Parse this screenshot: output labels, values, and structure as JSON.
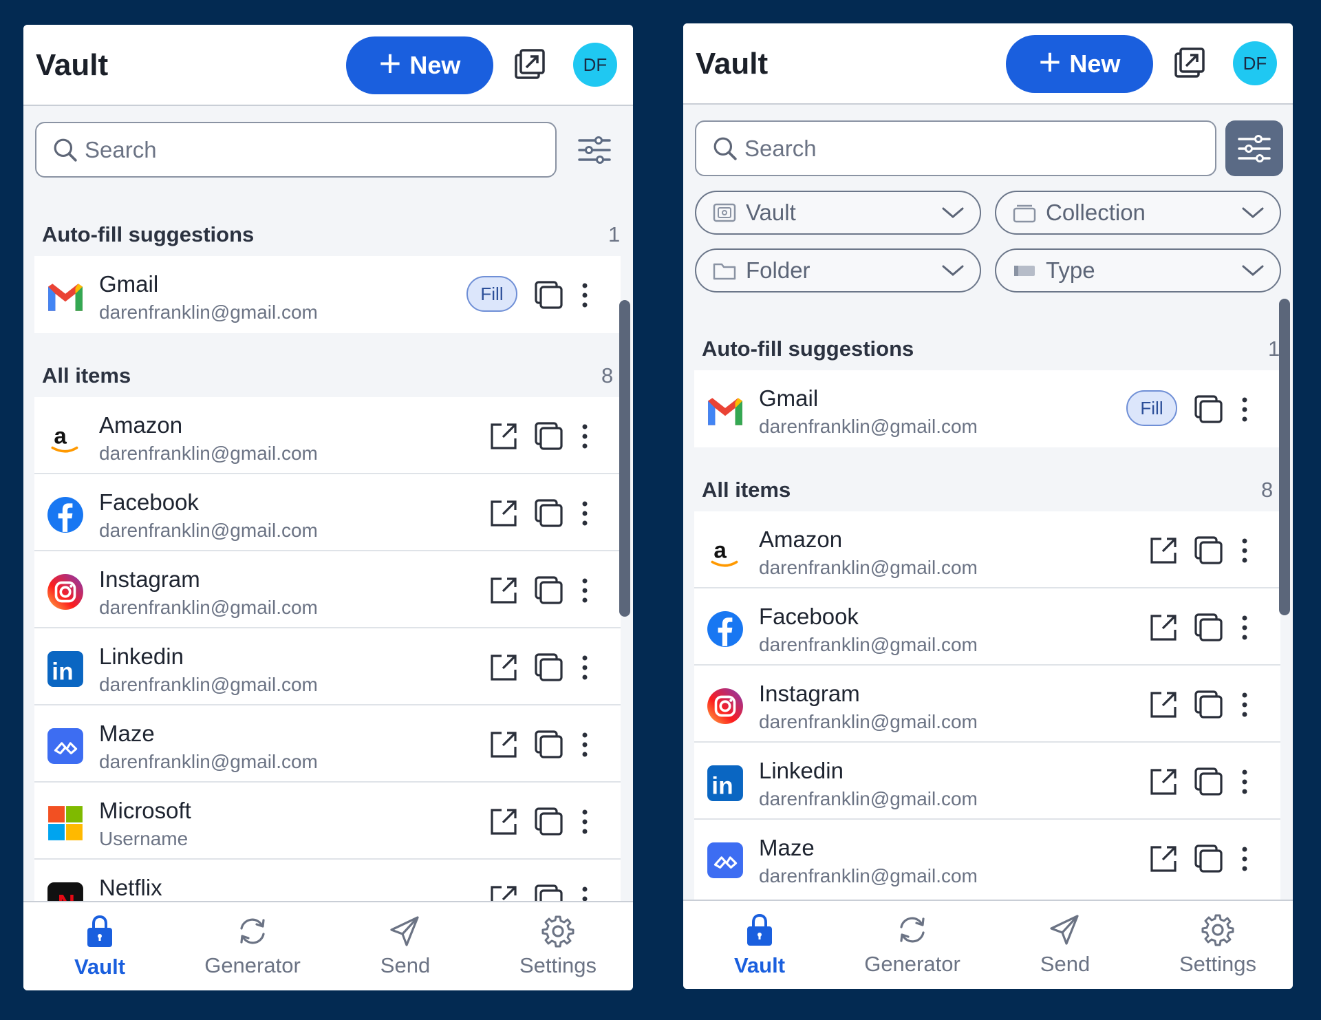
{
  "colors": {
    "background": "#032a52",
    "accent": "#1a5fde",
    "avatar": "#1fc8f2"
  },
  "vault_title": "Vault",
  "new_button_label": "New",
  "avatar_initials": "DF",
  "search_placeholder": "Search",
  "filters": {
    "vault": "Vault",
    "collection": "Collection",
    "folder": "Folder",
    "type": "Type"
  },
  "autofill": {
    "title": "Auto-fill suggestions",
    "count": "1",
    "fill_label": "Fill",
    "items": [
      {
        "name": "Gmail",
        "sub": "darenfranklin@gmail.com",
        "icon": "gmail-logo"
      }
    ]
  },
  "all_items": {
    "title": "All items",
    "count": "8",
    "items": [
      {
        "name": "Amazon",
        "sub": "darenfranklin@gmail.com",
        "icon": "amazon-logo"
      },
      {
        "name": "Facebook",
        "sub": "darenfranklin@gmail.com",
        "icon": "facebook-logo"
      },
      {
        "name": "Instagram",
        "sub": "darenfranklin@gmail.com",
        "icon": "instagram-logo"
      },
      {
        "name": "Linkedin",
        "sub": "darenfranklin@gmail.com",
        "icon": "linkedin-logo"
      },
      {
        "name": "Maze",
        "sub": "darenfranklin@gmail.com",
        "icon": "maze-logo"
      },
      {
        "name": "Microsoft",
        "sub": "Username",
        "icon": "microsoft-logo"
      },
      {
        "name": "Netflix",
        "sub": "",
        "icon": "netflix-logo"
      }
    ]
  },
  "tabs": [
    {
      "label": "Vault",
      "icon": "lock-icon",
      "active": true
    },
    {
      "label": "Generator",
      "icon": "refresh-icon",
      "active": false
    },
    {
      "label": "Send",
      "icon": "send-icon",
      "active": false
    },
    {
      "label": "Settings",
      "icon": "gear-icon",
      "active": false
    }
  ]
}
